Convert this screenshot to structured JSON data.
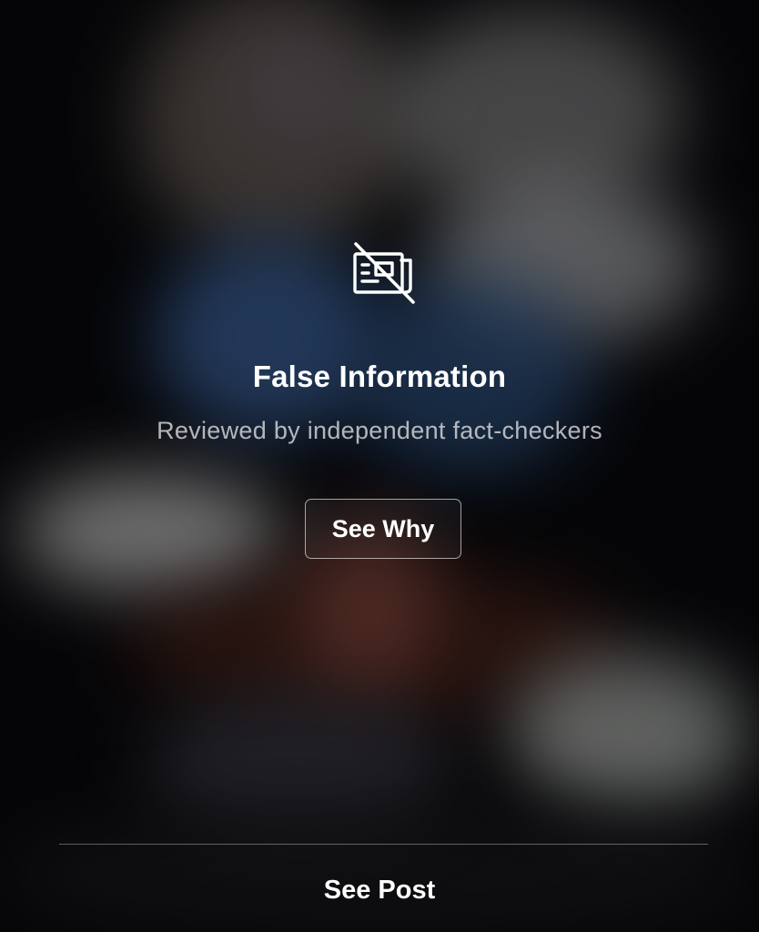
{
  "notice": {
    "icon": "newspaper-crossed-out-icon",
    "title": "False Information",
    "subtitle": "Reviewed by independent fact-checkers",
    "see_why_label": "See Why"
  },
  "footer": {
    "see_post_label": "See Post"
  },
  "colors": {
    "text": "#ffffff",
    "subtitle": "#c8c8cc",
    "button_border": "#9a9a9a"
  }
}
